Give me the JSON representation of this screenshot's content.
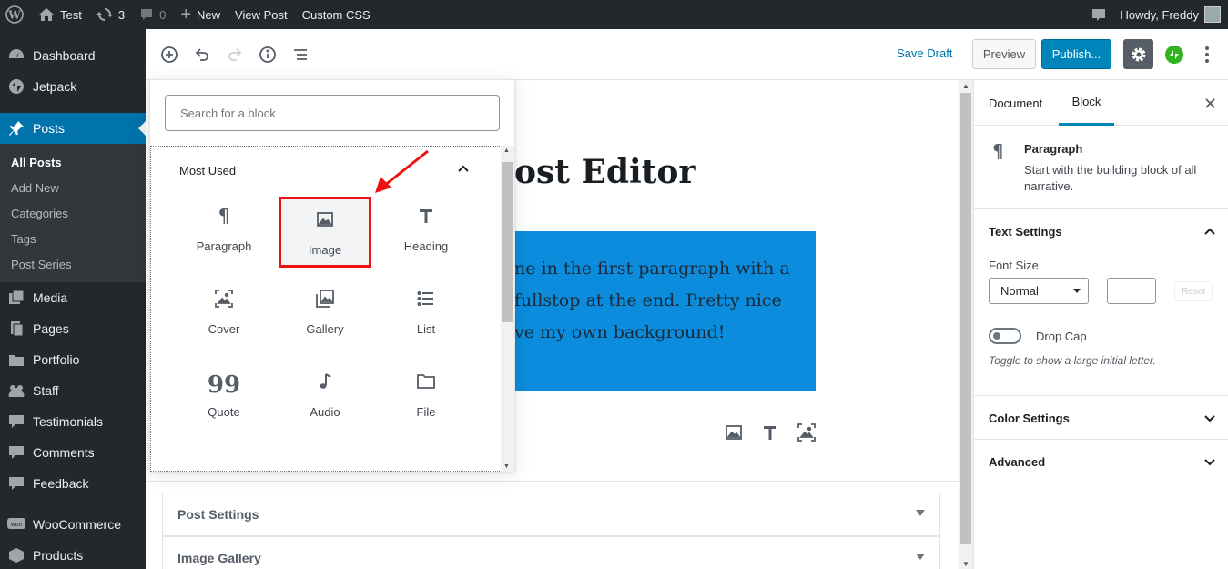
{
  "adminbar": {
    "site_name": "Test",
    "updates_count": "3",
    "comments_count": "0",
    "new_label": "New",
    "view_post_label": "View Post",
    "custom_css_label": "Custom CSS",
    "greeting": "Howdy, Freddy"
  },
  "sidebar": {
    "items": [
      {
        "label": "Dashboard",
        "icon": "dashboard-icon"
      },
      {
        "label": "Jetpack",
        "icon": "jetpack-icon"
      },
      {
        "label": "Posts",
        "icon": "pin-icon",
        "active": true
      },
      {
        "label": "Media",
        "icon": "media-icon"
      },
      {
        "label": "Pages",
        "icon": "pages-icon"
      },
      {
        "label": "Portfolio",
        "icon": "portfolio-icon"
      },
      {
        "label": "Staff",
        "icon": "staff-icon"
      },
      {
        "label": "Testimonials",
        "icon": "testimonials-icon"
      },
      {
        "label": "Comments",
        "icon": "comments-icon"
      },
      {
        "label": "Feedback",
        "icon": "feedback-icon"
      },
      {
        "label": "WooCommerce",
        "icon": "woocommerce-icon"
      },
      {
        "label": "Products",
        "icon": "products-icon"
      }
    ],
    "submenu": [
      "All Posts",
      "Add New",
      "Categories",
      "Tags",
      "Post Series"
    ]
  },
  "header": {
    "save_draft": "Save Draft",
    "preview": "Preview",
    "publish": "Publish..."
  },
  "canvas": {
    "title_fragment": "ost Editor",
    "paragraph_lines": [
      "ne in the first paragraph with a",
      "fullstop at the end. Pretty nice",
      "ve my own background!"
    ],
    "block_color": "#0b8cdc"
  },
  "inserter": {
    "search_placeholder": "Search for a block",
    "section_title": "Most Used",
    "blocks": [
      {
        "label": "Paragraph",
        "icon": "paragraph-icon"
      },
      {
        "label": "Image",
        "icon": "image-icon",
        "highlighted": true
      },
      {
        "label": "Heading",
        "icon": "heading-icon"
      },
      {
        "label": "Cover",
        "icon": "cover-icon"
      },
      {
        "label": "Gallery",
        "icon": "gallery-icon"
      },
      {
        "label": "List",
        "icon": "list-icon"
      },
      {
        "label": "Quote",
        "icon": "quote-icon"
      },
      {
        "label": "Audio",
        "icon": "audio-icon"
      },
      {
        "label": "File",
        "icon": "file-icon"
      }
    ]
  },
  "metaboxes": [
    "Post Settings",
    "Image Gallery"
  ],
  "settings_sidebar": {
    "tabs": [
      "Document",
      "Block"
    ],
    "active_tab": "Block",
    "block_name": "Paragraph",
    "block_desc_1": "Start with the building block of all",
    "block_desc_2": "narrative.",
    "text_settings": "Text Settings",
    "font_size_label": "Font Size",
    "font_size_value": "Normal",
    "reset": "Reset",
    "drop_cap": "Drop Cap",
    "drop_cap_help": "Toggle to show a large initial letter.",
    "color_settings": "Color Settings",
    "advanced": "Advanced"
  }
}
